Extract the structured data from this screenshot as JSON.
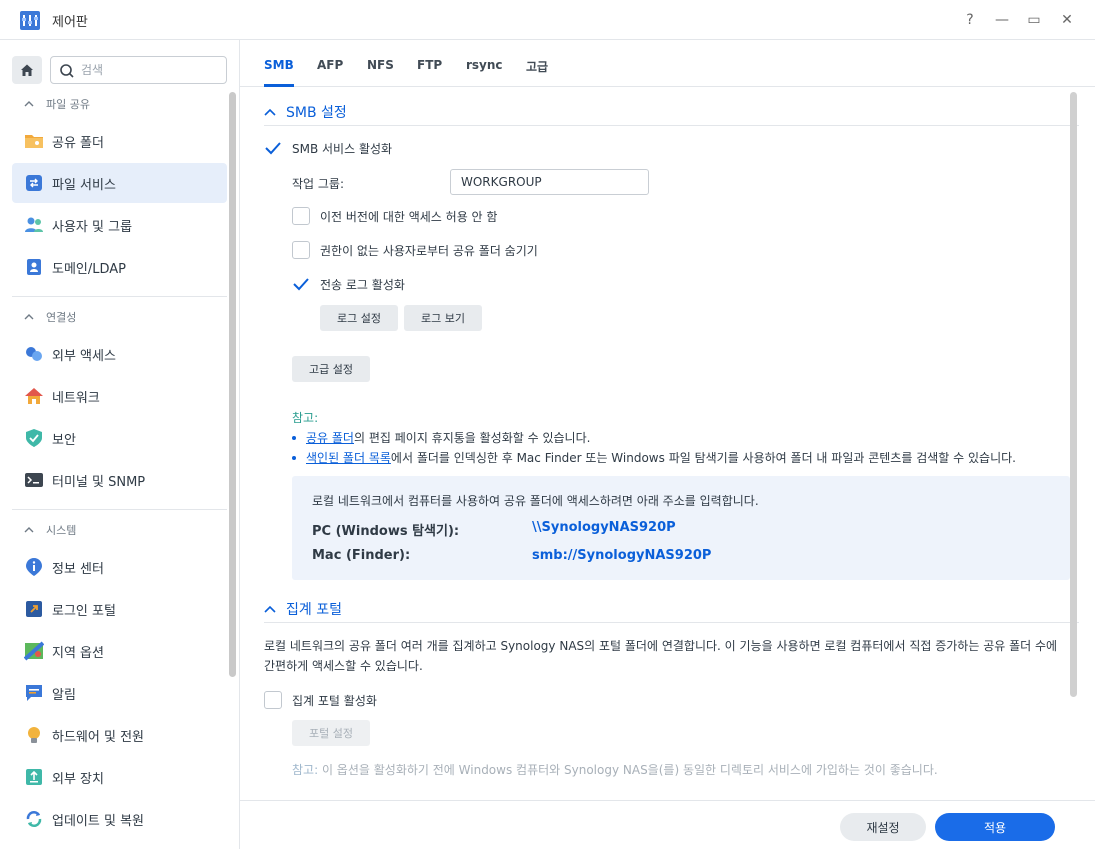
{
  "window": {
    "title": "제어판",
    "help": "?",
    "minimize": "—",
    "maximize": "▭",
    "close": "✕"
  },
  "sidebar": {
    "search_placeholder": "검색",
    "sections": [
      {
        "label": "파일 공유",
        "items": [
          "공유 폴더",
          "파일 서비스",
          "사용자 및 그룹",
          "도메인/LDAP"
        ]
      },
      {
        "label": "연결성",
        "items": [
          "외부 액세스",
          "네트워크",
          "보안",
          "터미널 및 SNMP"
        ]
      },
      {
        "label": "시스템",
        "items": [
          "정보 센터",
          "로그인 포털",
          "지역 옵션",
          "알림",
          "하드웨어 및 전원",
          "외부 장치",
          "업데이트 및 복원"
        ]
      }
    ],
    "active_item": "파일 서비스"
  },
  "tabs": [
    "SMB",
    "AFP",
    "NFS",
    "FTP",
    "rsync",
    "고급"
  ],
  "active_tab": "SMB",
  "smb": {
    "section_title": "SMB 설정",
    "enable_label": "SMB 서비스 활성화",
    "enable_checked": true,
    "workgroup_label": "작업 그룹:",
    "workgroup_value": "WORKGROUP",
    "prev_version_label": "이전 버전에 대한 액세스 허용 안 함",
    "prev_version_checked": false,
    "hide_folders_label": "권한이 없는 사용자로부터 공유 폴더 숨기기",
    "hide_folders_checked": false,
    "transfer_log_label": "전송 로그 활성화",
    "transfer_log_checked": true,
    "log_settings_button": "로그 설정",
    "view_log_button": "로그 보기",
    "advanced_button": "고급 설정",
    "note_title": "참고:",
    "note1_link": "공유 폴더",
    "note1_text": "의 편집 페이지 휴지통을 활성화할 수 있습니다.",
    "note2_link": "색인된 폴더 목록",
    "note2_text": "에서 폴더를 인덱싱한 후 Mac Finder 또는 Windows 파일 탐색기를 사용하여 폴더 내 파일과 콘텐츠를 검색할 수 있습니다.",
    "info_text": "로컬 네트워크에서 컴퓨터를 사용하여 공유 폴더에 액세스하려면 아래 주소를 입력합니다.",
    "pc_label": "PC (Windows 탐색기):",
    "pc_value": "\\\\SynologyNAS920P",
    "mac_label": "Mac (Finder):",
    "mac_value": "smb://SynologyNAS920P"
  },
  "portal": {
    "section_title": "집계 포털",
    "description": "로컬 네트워크의 공유 폴더 여러 개를 집계하고 Synology NAS의 포털 폴더에 연결합니다. 이 기능을 사용하면 로컬 컴퓨터에서 직접 증가하는 공유 폴더 수에 간편하게 액세스할 수 있습니다.",
    "enable_label": "집계 포털 활성화",
    "enable_checked": false,
    "settings_button": "포털 설정",
    "hint_title": "참고:",
    "hint_text": "이 옵션을 활성화하기 전에 Windows 컴퓨터와 Synology NAS을(를) 동일한 디렉토리 서비스에 가입하는 것이 좋습니다."
  },
  "footer": {
    "reset_button": "재설정",
    "apply_button": "적용"
  },
  "colors": {
    "accent": "#0a5fd9",
    "apply_bg": "#1a6ce8",
    "active_bg": "#e6eefa",
    "info_bg": "#eef3fb"
  }
}
